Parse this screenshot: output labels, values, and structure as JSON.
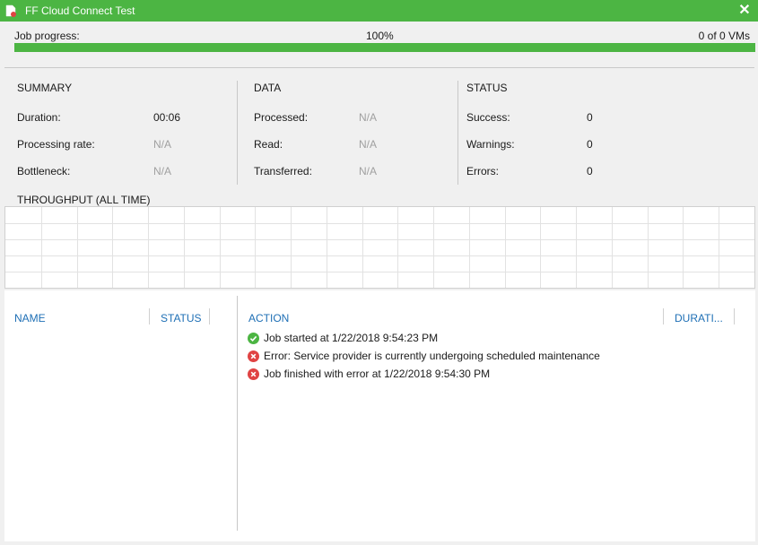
{
  "window": {
    "title": "FF Cloud Connect Test"
  },
  "progress": {
    "label": "Job progress:",
    "percent_text": "100%",
    "count_text": "0 of 0 VMs",
    "fraction": 1.0,
    "color": "#4cb543"
  },
  "summary": {
    "heading": "SUMMARY",
    "duration_label": "Duration:",
    "duration_value": "00:06",
    "rate_label": "Processing rate:",
    "rate_value": "N/A",
    "bottleneck_label": "Bottleneck:",
    "bottleneck_value": "N/A"
  },
  "data": {
    "heading": "DATA",
    "processed_label": "Processed:",
    "processed_value": "N/A",
    "read_label": "Read:",
    "read_value": "N/A",
    "transferred_label": "Transferred:",
    "transferred_value": "N/A"
  },
  "status": {
    "heading": "STATUS",
    "success_label": "Success:",
    "success_value": "0",
    "warnings_label": "Warnings:",
    "warnings_value": "0",
    "errors_label": "Errors:",
    "errors_value": "0"
  },
  "throughput": {
    "title": "THROUGHPUT (ALL TIME)"
  },
  "vm_list": {
    "col_name": "NAME",
    "col_status": "STATUS"
  },
  "log": {
    "col_action": "ACTION",
    "col_duration": "DURATI...",
    "entries": [
      {
        "icon": "success-icon",
        "text": "Job started at 1/22/2018 9:54:23 PM"
      },
      {
        "icon": "error-icon",
        "text": "Error: Service provider is currently undergoing scheduled maintenance"
      },
      {
        "icon": "error-icon",
        "text": "Job finished with error at 1/22/2018 9:54:30 PM"
      }
    ]
  },
  "colors": {
    "accent": "#4cb543",
    "error": "#e04343",
    "link": "#1e6fb5"
  }
}
